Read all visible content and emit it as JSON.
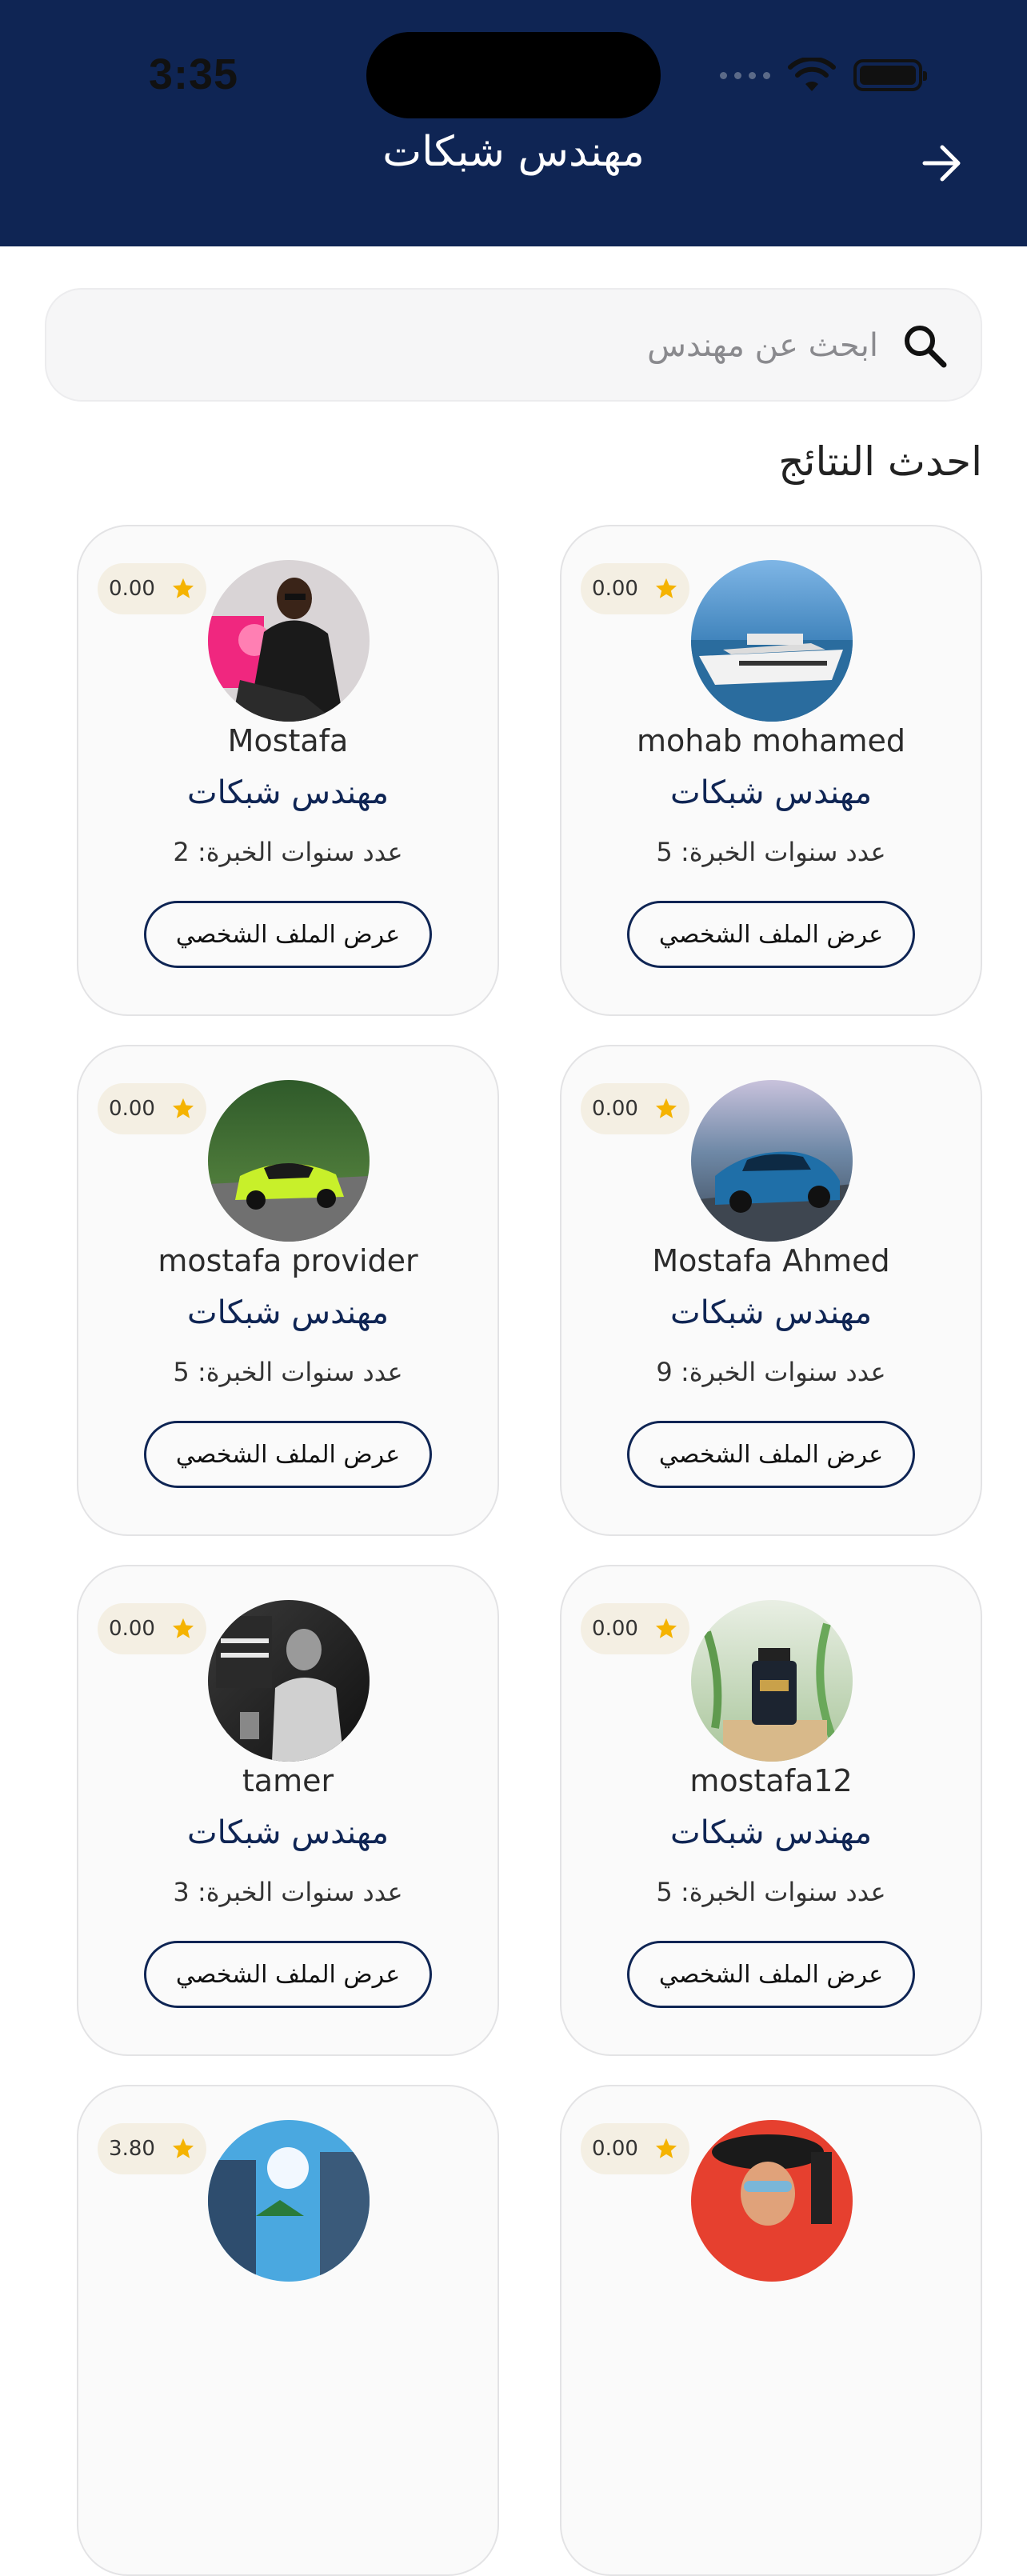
{
  "status_bar": {
    "time": "3:35"
  },
  "header": {
    "title": "مهندس شبكات",
    "back_icon": "arrow-right-icon"
  },
  "search": {
    "placeholder": "ابحث عن مهندس",
    "value": ""
  },
  "section_title": "احدث النتائج",
  "colors": {
    "primary": "#0f2554",
    "star": "#f5b301",
    "rating_bg": "#f4efe3"
  },
  "engineers": [
    {
      "name": "mohab mohamed",
      "role": "مهندس شبكات",
      "experience": "عدد سنوات الخبرة: 5",
      "rating": "0.00",
      "button": "عرض الملف الشخصي",
      "avatar": "yacht-photo"
    },
    {
      "name": "Mostafa",
      "role": "مهندس شبكات",
      "experience": "عدد سنوات الخبرة: 2",
      "rating": "0.00",
      "button": "عرض الملف الشخصي",
      "avatar": "man-portrait-photo"
    },
    {
      "name": "Mostafa Ahmed",
      "role": "مهندس شبكات",
      "experience": "عدد سنوات الخبرة: 9",
      "rating": "0.00",
      "button": "عرض الملف الشخصي",
      "avatar": "blue-car-photo"
    },
    {
      "name": "mostafa provider",
      "role": "مهندس شبكات",
      "experience": "عدد سنوات الخبرة: 5",
      "rating": "0.00",
      "button": "عرض الملف الشخصي",
      "avatar": "green-sports-car-photo"
    },
    {
      "name": "mostafa12",
      "role": "مهندس شبكات",
      "experience": "عدد سنوات الخبرة: 5",
      "rating": "0.00",
      "button": "عرض الملف الشخصي",
      "avatar": "perfume-bottle-photo"
    },
    {
      "name": "tamer",
      "role": "مهندس شبكات",
      "experience": "عدد سنوات الخبرة: 3",
      "rating": "0.00",
      "button": "عرض الملف الشخصي",
      "avatar": "gentleman-photo"
    },
    {
      "rating": "0.00",
      "avatar": "traveler-photo"
    },
    {
      "rating": "3.80",
      "avatar": "city-street-photo"
    }
  ]
}
